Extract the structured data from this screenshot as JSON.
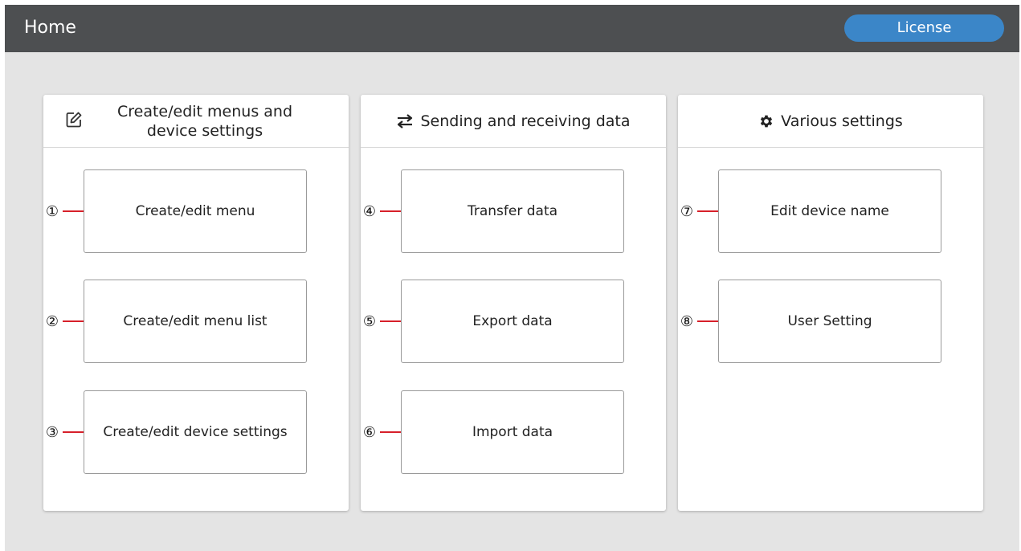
{
  "header": {
    "title": "Home",
    "license_label": "License",
    "license_color": "#3b86c8",
    "bar_color": "#4d4f51"
  },
  "panels": [
    {
      "title": "Create/edit menus and device settings",
      "icon": "edit-icon",
      "buttons": [
        {
          "callout": "①",
          "label": "Create/edit menu"
        },
        {
          "callout": "②",
          "label": "Create/edit menu list"
        },
        {
          "callout": "③",
          "label": "Create/edit device settings"
        }
      ]
    },
    {
      "title": "Sending and receiving data",
      "icon": "swap-arrows-icon",
      "buttons": [
        {
          "callout": "④",
          "label": "Transfer data"
        },
        {
          "callout": "⑤",
          "label": "Export data"
        },
        {
          "callout": "⑥",
          "label": "Import data"
        }
      ]
    },
    {
      "title": "Various settings",
      "icon": "gear-icon",
      "buttons": [
        {
          "callout": "⑦",
          "label": "Edit device name"
        },
        {
          "callout": "⑧",
          "label": "User Setting"
        }
      ]
    }
  ],
  "callout_line_color": "#d7202a"
}
